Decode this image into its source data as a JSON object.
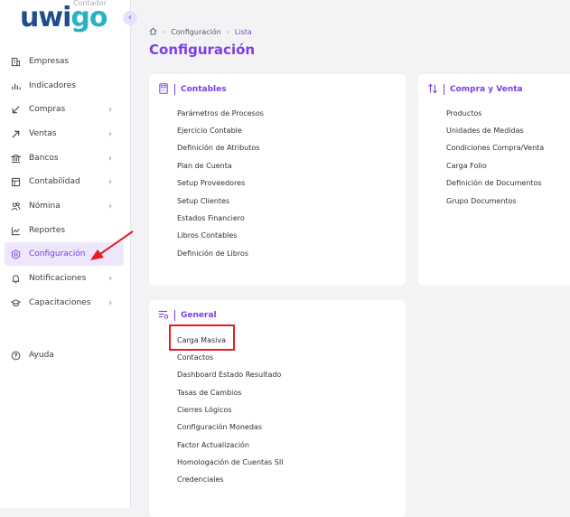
{
  "brand": {
    "logo_main": "uwi",
    "logo_accent": "go",
    "logo_sub": "Contador"
  },
  "sidebar": {
    "collapse_icon": "‹",
    "items": [
      {
        "label": "Empresas",
        "icon": "building-icon",
        "chevron": false
      },
      {
        "label": "Indicadores",
        "icon": "bar-chart-icon",
        "chevron": false
      },
      {
        "label": "Compras",
        "icon": "arrow-down-left-icon",
        "chevron": true
      },
      {
        "label": "Ventas",
        "icon": "arrow-up-right-icon",
        "chevron": true
      },
      {
        "label": "Bancos",
        "icon": "bank-icon",
        "chevron": true
      },
      {
        "label": "Contabilidad",
        "icon": "ledger-icon",
        "chevron": true
      },
      {
        "label": "Nómina",
        "icon": "users-icon",
        "chevron": true
      },
      {
        "label": "Reportes",
        "icon": "line-chart-icon",
        "chevron": false
      },
      {
        "label": "Configuración",
        "icon": "gear-icon",
        "chevron": false,
        "active": true
      },
      {
        "label": "Notificaciones",
        "icon": "bell-icon",
        "chevron": true
      },
      {
        "label": "Capacitaciones",
        "icon": "graduation-cap-icon",
        "chevron": true
      }
    ],
    "help_label": "Ayuda"
  },
  "breadcrumb": {
    "items": [
      "Configuración",
      "Lista"
    ]
  },
  "page_title": "Configuración",
  "cards": {
    "contables": {
      "title": "Contables",
      "icon": "calculator-icon",
      "links": [
        "Parámetros de Procesos",
        "Ejercicio Contable",
        "Definición de Atributos",
        "Plan de Cuenta",
        "Setup Proveedores",
        "Setup Clientes",
        "Estados Financiero",
        "Libros Contables",
        "Definición de Libros"
      ]
    },
    "compra_venta": {
      "title": "Compra y Venta",
      "icon": "swap-arrows-icon",
      "links": [
        "Productos",
        "Unidades de Medidas",
        "Condiciones Compra/Venta",
        "Carga Folio",
        "Definición de Documentos",
        "Grupo Documentos"
      ]
    },
    "general": {
      "title": "General",
      "icon": "filter-settings-icon",
      "links": [
        "Carga Masiva",
        "Contactos",
        "Dashboard Estado Resultado",
        "Tasas de Cambios",
        "Cierres Lógicos",
        "Configuración Monedas",
        "Factor Actualización",
        "Homologación de Cuentas SII",
        "Credenciales"
      ]
    }
  },
  "colors": {
    "accent": "#7b3fe4",
    "annotation": "#e41e26",
    "logo_blue": "#1e4e8c",
    "logo_teal": "#27b3c2"
  }
}
